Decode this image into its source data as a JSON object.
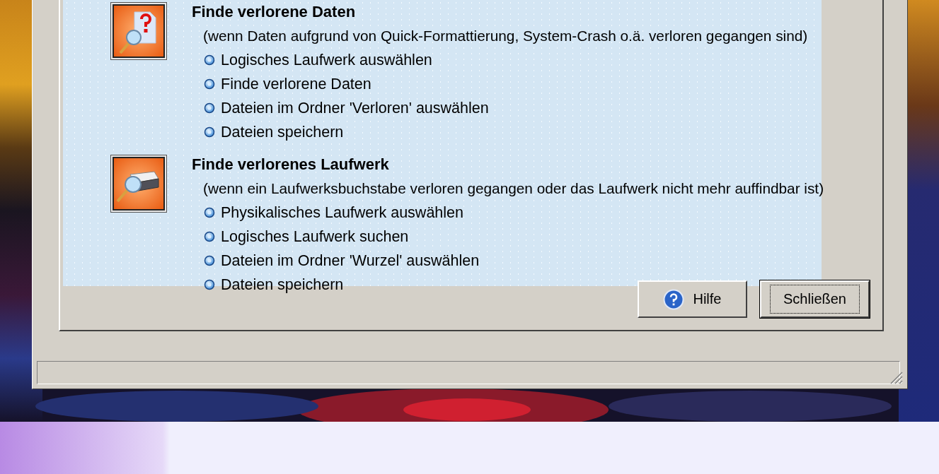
{
  "sections": [
    {
      "title": "Finde verlorene Daten",
      "description": "(wenn Daten aufgrund von Quick-Formattierung, System-Crash o.ä. verloren gegangen sind)",
      "steps": [
        "Logisches Laufwerk auswählen",
        "Finde verlorene Daten",
        "Dateien im Ordner 'Verloren' auswählen",
        "Dateien speichern"
      ]
    },
    {
      "title": "Finde verlorenes Laufwerk",
      "description": "(wenn ein Laufwerksbuchstabe verloren gegangen oder das Laufwerk nicht mehr auffindbar ist)",
      "steps": [
        "Physikalisches Laufwerk auswählen",
        "Logisches Laufwerk suchen",
        "Dateien im Ordner 'Wurzel' auswählen",
        "Dateien speichern"
      ]
    }
  ],
  "buttons": [
    {
      "label": "Hilfe",
      "kind": "help"
    },
    {
      "label": "Schließen",
      "kind": "default"
    }
  ]
}
